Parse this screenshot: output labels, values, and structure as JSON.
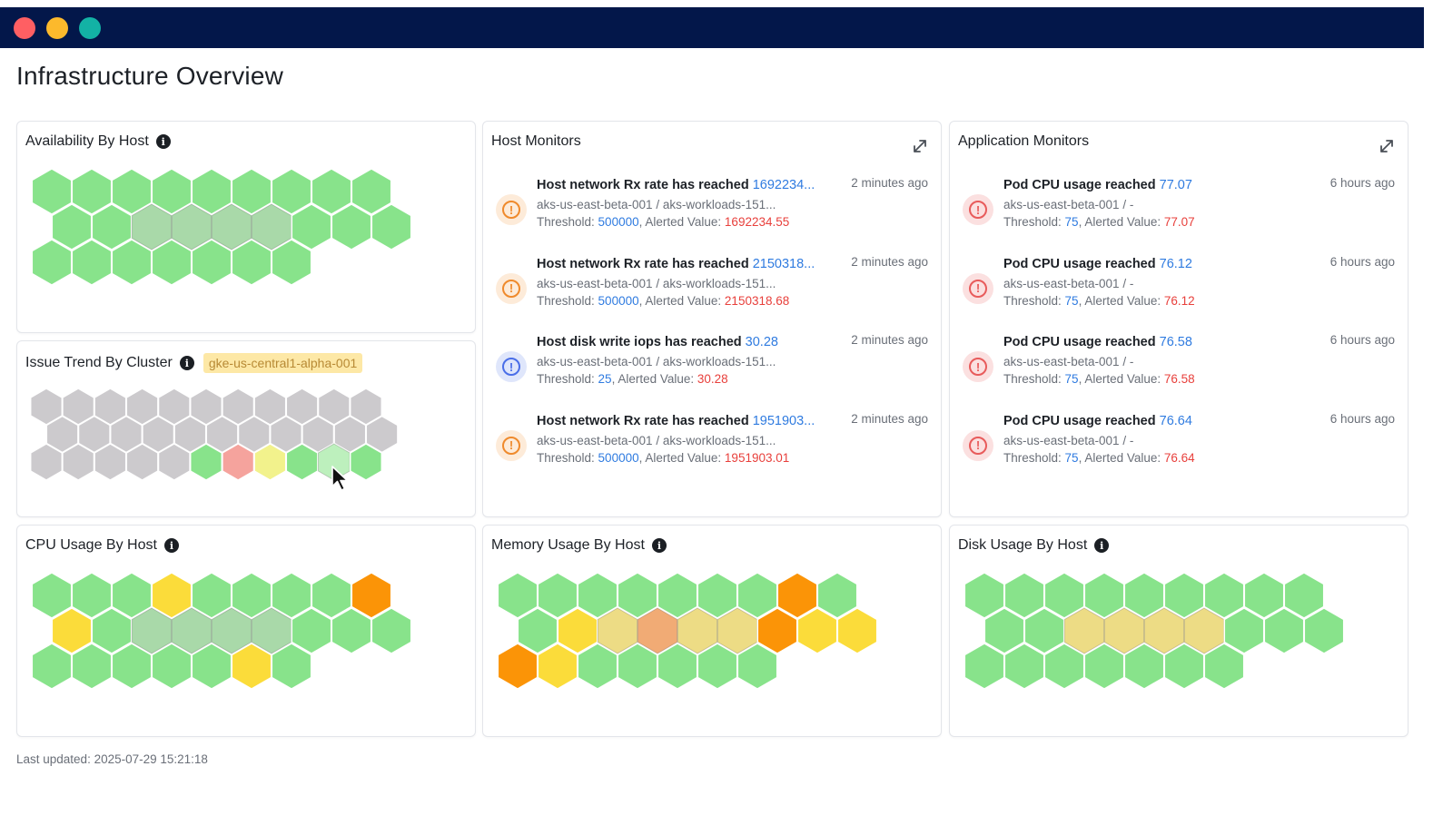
{
  "window": {
    "controls": [
      "close",
      "minimize",
      "maximize"
    ]
  },
  "page": {
    "title": "Infrastructure Overview"
  },
  "colors": {
    "green": "#88e38b",
    "green_light": "#bdf0bd",
    "green_selected": "#a9d9a9",
    "grey": "#cccacd",
    "red_light": "#f5a39d",
    "yellow_light": "#f2f28c",
    "yellow": "#fbdc3a",
    "yellow_muted": "#eddc85",
    "orange": "#fb9407",
    "orange_muted": "#f1ab75",
    "link_blue": "#2f7be0",
    "alert_red": "#e8403c"
  },
  "panels": {
    "availability": {
      "title": "Availability By Host",
      "info_icon": "info-icon",
      "hexes": [
        [
          "g",
          "g",
          "g",
          "g",
          "g",
          "g",
          "g",
          "g",
          "g"
        ],
        [
          "g",
          "g",
          "s",
          "s",
          "s",
          "s",
          "g",
          "g",
          "g"
        ],
        [
          "g",
          "g",
          "g",
          "g",
          "g",
          "g",
          "g"
        ]
      ]
    },
    "issue_trend": {
      "title": "Issue Trend By Cluster",
      "info_icon": "info-icon",
      "cluster": "gke-us-central1-alpha-001",
      "hexes": [
        [
          "x",
          "x",
          "x",
          "x",
          "x",
          "x",
          "x",
          "x",
          "x",
          "x",
          "x"
        ],
        [
          "x",
          "x",
          "x",
          "x",
          "x",
          "x",
          "x",
          "x",
          "x",
          "x",
          "x"
        ],
        [
          "x",
          "x",
          "x",
          "x",
          "x",
          "g",
          "r",
          "y",
          "g",
          "l",
          "g"
        ]
      ]
    },
    "host_monitors": {
      "title": "Host Monitors",
      "expand_icon": "expand-icon",
      "alerts": [
        {
          "severity": "warn",
          "icon": "warning-icon",
          "title": "Host network Rx rate has reached ",
          "value": "1692234...",
          "path": "aks-us-east-beta-001 / aks-workloads-151...",
          "threshold_label": "Threshold: ",
          "threshold": "500000",
          "alerted_label": ", Alerted Value: ",
          "alerted": "1692234.55",
          "time": "2 minutes ago"
        },
        {
          "severity": "warn",
          "icon": "warning-icon",
          "title": "Host network Rx rate has reached ",
          "value": "2150318...",
          "path": "aks-us-east-beta-001 / aks-workloads-151...",
          "threshold_label": "Threshold: ",
          "threshold": "500000",
          "alerted_label": ", Alerted Value: ",
          "alerted": "2150318.68",
          "time": "2 minutes ago"
        },
        {
          "severity": "info",
          "icon": "info-alert-icon",
          "title": "Host disk write iops has reached ",
          "value": "30.28",
          "path": "aks-us-east-beta-001 / aks-workloads-151...",
          "threshold_label": "Threshold: ",
          "threshold": "25",
          "alerted_label": ", Alerted Value: ",
          "alerted": "30.28",
          "time": "2 minutes ago"
        },
        {
          "severity": "warn",
          "icon": "warning-icon",
          "title": "Host network Rx rate has reached ",
          "value": "1951903...",
          "path": "aks-us-east-beta-001 / aks-workloads-151...",
          "threshold_label": "Threshold: ",
          "threshold": "500000",
          "alerted_label": ", Alerted Value: ",
          "alerted": "1951903.01",
          "time": "2 minutes ago"
        }
      ]
    },
    "app_monitors": {
      "title": "Application Monitors",
      "expand_icon": "expand-icon",
      "alerts": [
        {
          "severity": "crit",
          "icon": "critical-icon",
          "title": "Pod CPU usage reached ",
          "value": "77.07",
          "path": "aks-us-east-beta-001 / -",
          "threshold_label": "Threshold: ",
          "threshold": "75",
          "alerted_label": ", Alerted Value: ",
          "alerted": "77.07",
          "time": "6 hours ago"
        },
        {
          "severity": "crit",
          "icon": "critical-icon",
          "title": "Pod CPU usage reached ",
          "value": "76.12",
          "path": "aks-us-east-beta-001 / -",
          "threshold_label": "Threshold: ",
          "threshold": "75",
          "alerted_label": ", Alerted Value: ",
          "alerted": "76.12",
          "time": "6 hours ago"
        },
        {
          "severity": "crit",
          "icon": "critical-icon",
          "title": "Pod CPU usage reached ",
          "value": "76.58",
          "path": "aks-us-east-beta-001 / -",
          "threshold_label": "Threshold: ",
          "threshold": "75",
          "alerted_label": ", Alerted Value: ",
          "alerted": "76.58",
          "time": "6 hours ago"
        },
        {
          "severity": "crit",
          "icon": "critical-icon",
          "title": "Pod CPU usage reached ",
          "value": "76.64",
          "path": "aks-us-east-beta-001 / -",
          "threshold_label": "Threshold: ",
          "threshold": "75",
          "alerted_label": ", Alerted Value: ",
          "alerted": "76.64",
          "time": "6 hours ago"
        }
      ]
    },
    "cpu": {
      "title": "CPU Usage By Host",
      "info_icon": "info-icon",
      "hexes": [
        [
          "g",
          "g",
          "g",
          "Y",
          "g",
          "g",
          "g",
          "g",
          "O"
        ],
        [
          "Y",
          "g",
          "s",
          "s",
          "s",
          "s",
          "g",
          "g",
          "g"
        ],
        [
          "g",
          "g",
          "g",
          "g",
          "g",
          "Y",
          "g"
        ]
      ]
    },
    "memory": {
      "title": "Memory Usage By Host",
      "info_icon": "info-icon",
      "hexes": [
        [
          "g",
          "g",
          "g",
          "g",
          "g",
          "g",
          "g",
          "O",
          "g"
        ],
        [
          "g",
          "Y",
          "m",
          "p",
          "m",
          "m",
          "O",
          "Y",
          "Y"
        ],
        [
          "O",
          "Y",
          "g",
          "g",
          "g",
          "g",
          "g"
        ]
      ]
    },
    "disk": {
      "title": "Disk Usage By Host",
      "info_icon": "info-icon",
      "hexes": [
        [
          "g",
          "g",
          "g",
          "g",
          "g",
          "g",
          "g",
          "g",
          "g"
        ],
        [
          "g",
          "g",
          "m",
          "m",
          "m",
          "m",
          "g",
          "g",
          "g"
        ],
        [
          "g",
          "g",
          "g",
          "g",
          "g",
          "g",
          "g"
        ]
      ]
    }
  },
  "footer": {
    "last_updated": "Last updated: 2025-07-29 15:21:18"
  }
}
